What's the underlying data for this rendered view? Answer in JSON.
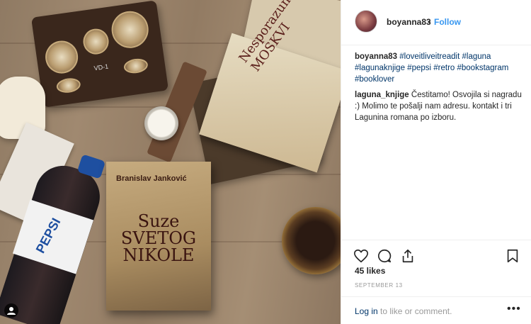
{
  "photo": {
    "radio_label": "VD-1",
    "book_title_lines": [
      "Suze",
      "SVETOG",
      "NIKOLE"
    ],
    "book_author": "Branislav Janković",
    "side_book_title": "Nesporazum u MOSKVI",
    "bottle_brand": "PEPSI"
  },
  "header": {
    "username": "boyanna83",
    "separator": "•",
    "follow_label": "Follow"
  },
  "comments": [
    {
      "user": "boyanna83",
      "text": "#loveitliveitreadit #laguna #lagunaknjige #pepsi #retro #bookstagram #booklover"
    },
    {
      "user": "laguna_knjige",
      "text": "Čestitamo! Osvojila si nagradu :) Molimo te pošalji nam adresu. kontakt i tri Lagunina romana po izboru."
    }
  ],
  "likes": "45 likes",
  "date": "SEPTEMBER 13",
  "footer": {
    "login_link": "Log in",
    "login_rest": " to like or comment.",
    "more": "•••"
  },
  "icons": [
    "heart-icon",
    "comment-icon",
    "share-icon",
    "bookmark-icon",
    "user-tag-icon"
  ]
}
